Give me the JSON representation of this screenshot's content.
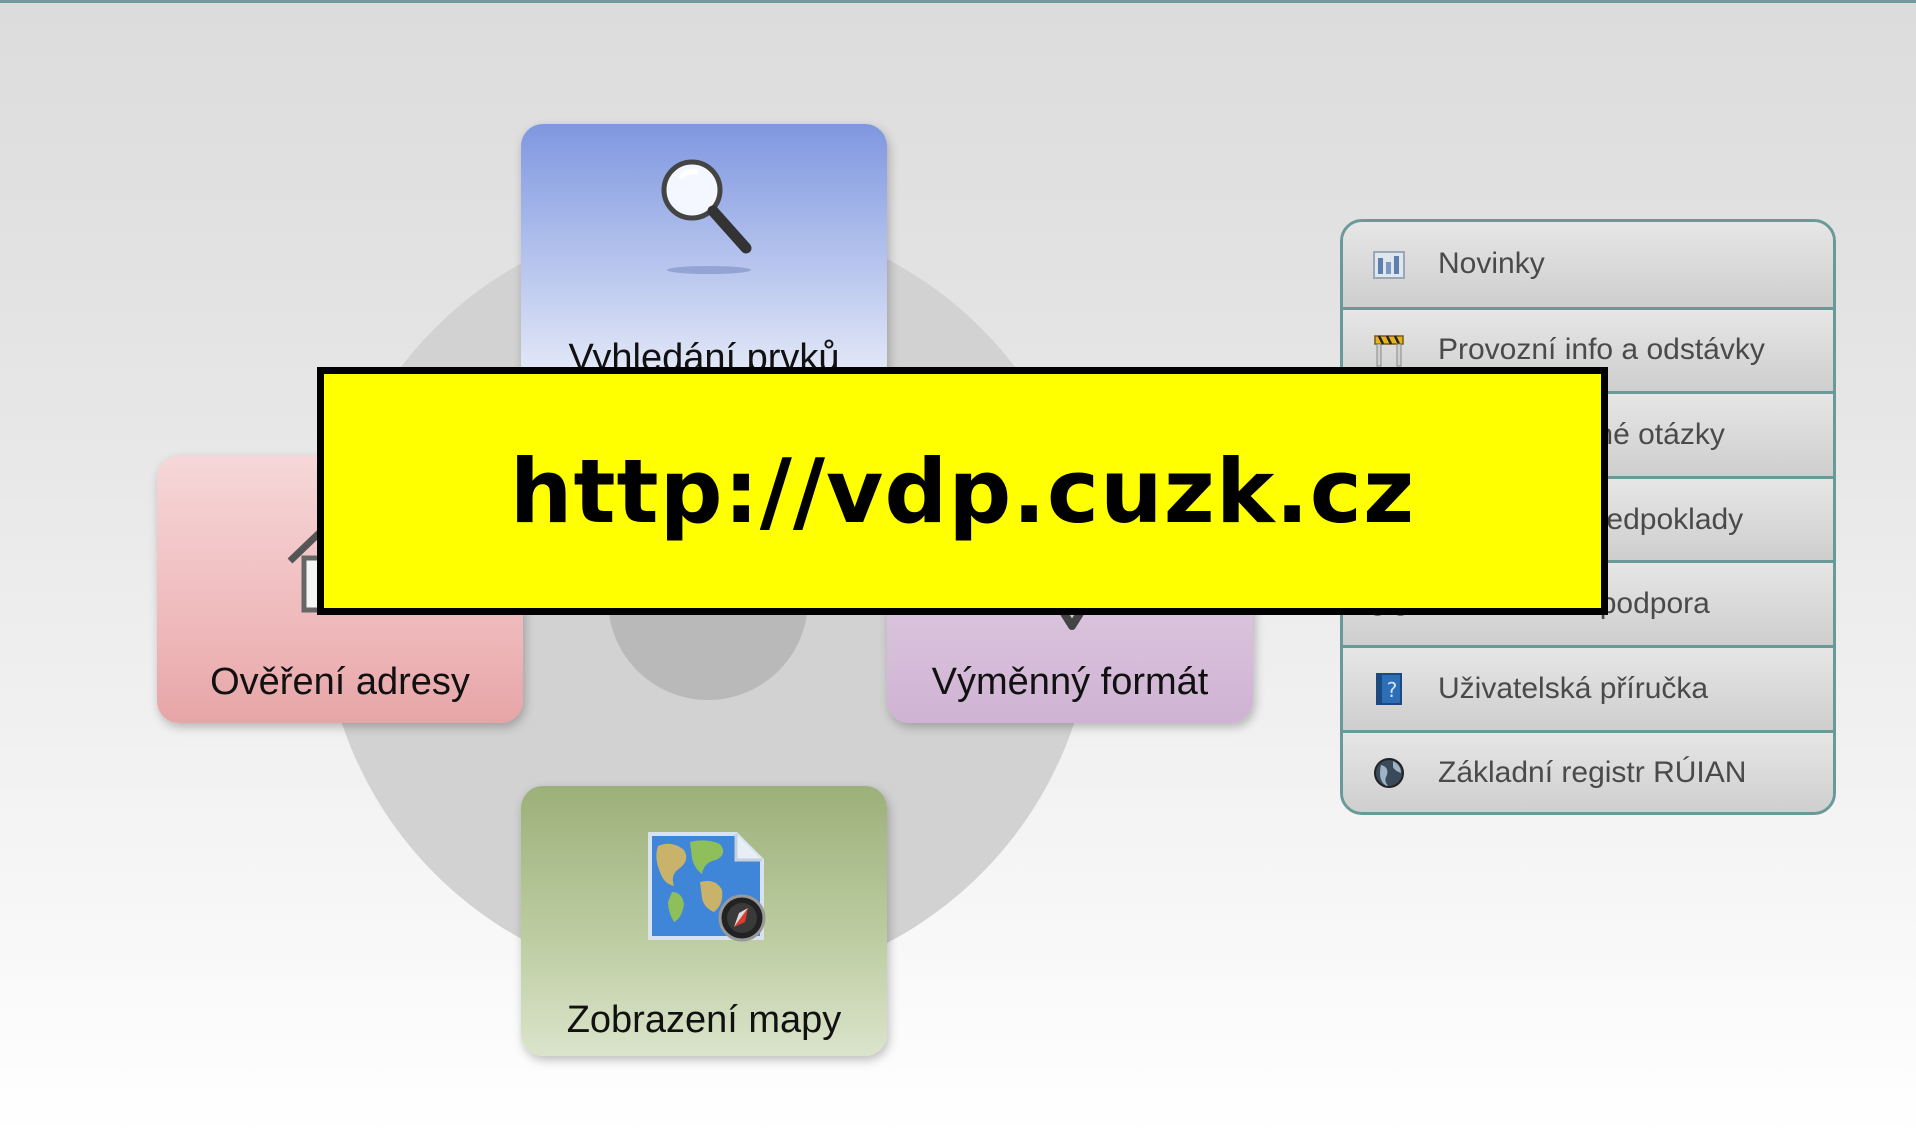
{
  "banner": {
    "url": "http://vdp.cuzk.cz"
  },
  "tiles": {
    "search": {
      "label": "Vyhledání prvků"
    },
    "address": {
      "label": "Ověření adresy"
    },
    "exchange": {
      "label": "Výměnný formát"
    },
    "map": {
      "label": "Zobrazení mapy"
    }
  },
  "links": {
    "items": [
      {
        "label": "Novinky",
        "icon": "news-icon"
      },
      {
        "label": "Provozní info a odstávky",
        "icon": "roadblock-icon"
      },
      {
        "label": "Často kladené otázky",
        "icon": "question-icon"
      },
      {
        "label": "Technické předpoklady",
        "icon": "gear-icon"
      },
      {
        "label": "Uživatelská podpora",
        "icon": "support-icon"
      },
      {
        "label": "Uživatelská příručka",
        "icon": "help-book-icon"
      },
      {
        "label": "Základní registr RÚIAN",
        "icon": "globe-icon"
      }
    ]
  },
  "colors": {
    "banner_bg": "#ffff00",
    "panel_border": "#6a9a97",
    "search_tile": "#7f97e0",
    "address_tile": "#eeb6b8",
    "exchange_tile": "#d7bfda",
    "map_tile": "#bccca0"
  }
}
